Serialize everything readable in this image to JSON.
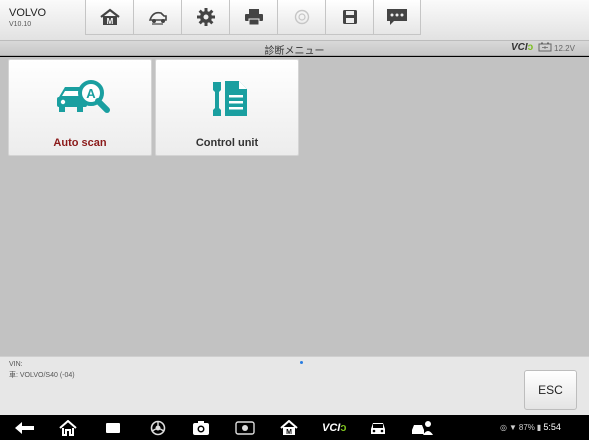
{
  "header": {
    "vehicle_name": "VOLVO",
    "vehicle_version": "V10.10",
    "toolbar": [
      {
        "icon": "home-icon"
      },
      {
        "icon": "vehicle-swap-icon"
      },
      {
        "icon": "settings-icon"
      },
      {
        "icon": "print-icon"
      },
      {
        "icon": "help-icon"
      },
      {
        "icon": "save-icon"
      },
      {
        "icon": "data-logging-icon"
      }
    ]
  },
  "titlebar": {
    "title": "診断メニュー",
    "vci_prefix": "VCI",
    "battery_voltage": "12.2V"
  },
  "tiles": [
    {
      "label": "Auto scan",
      "icon": "auto-scan-icon",
      "label_color": "#8b1a1a"
    },
    {
      "label": "Control unit",
      "icon": "control-unit-icon",
      "label_color": "#333333"
    }
  ],
  "footer": {
    "vin_label": "VIN:",
    "vehicle_path": "車: VOLVO/S40 (-04)",
    "esc_label": "ESC"
  },
  "navbar": {
    "icons": [
      "back-icon",
      "home-nav-icon",
      "recent-apps-icon",
      "browser-icon",
      "camera-icon",
      "screen-record-icon",
      "maxisys-home-icon",
      "vci-nav-icon",
      "vehicle-nav-icon",
      "repair-shop-icon"
    ],
    "status": {
      "battery_percent": "87%",
      "time": "5:54"
    }
  },
  "colors": {
    "accent_teal": "#1a9fa0",
    "accent_green": "#7cbf1f",
    "auto_scan_red": "#8b1a1a",
    "content_bg": "#c2c2c2"
  }
}
